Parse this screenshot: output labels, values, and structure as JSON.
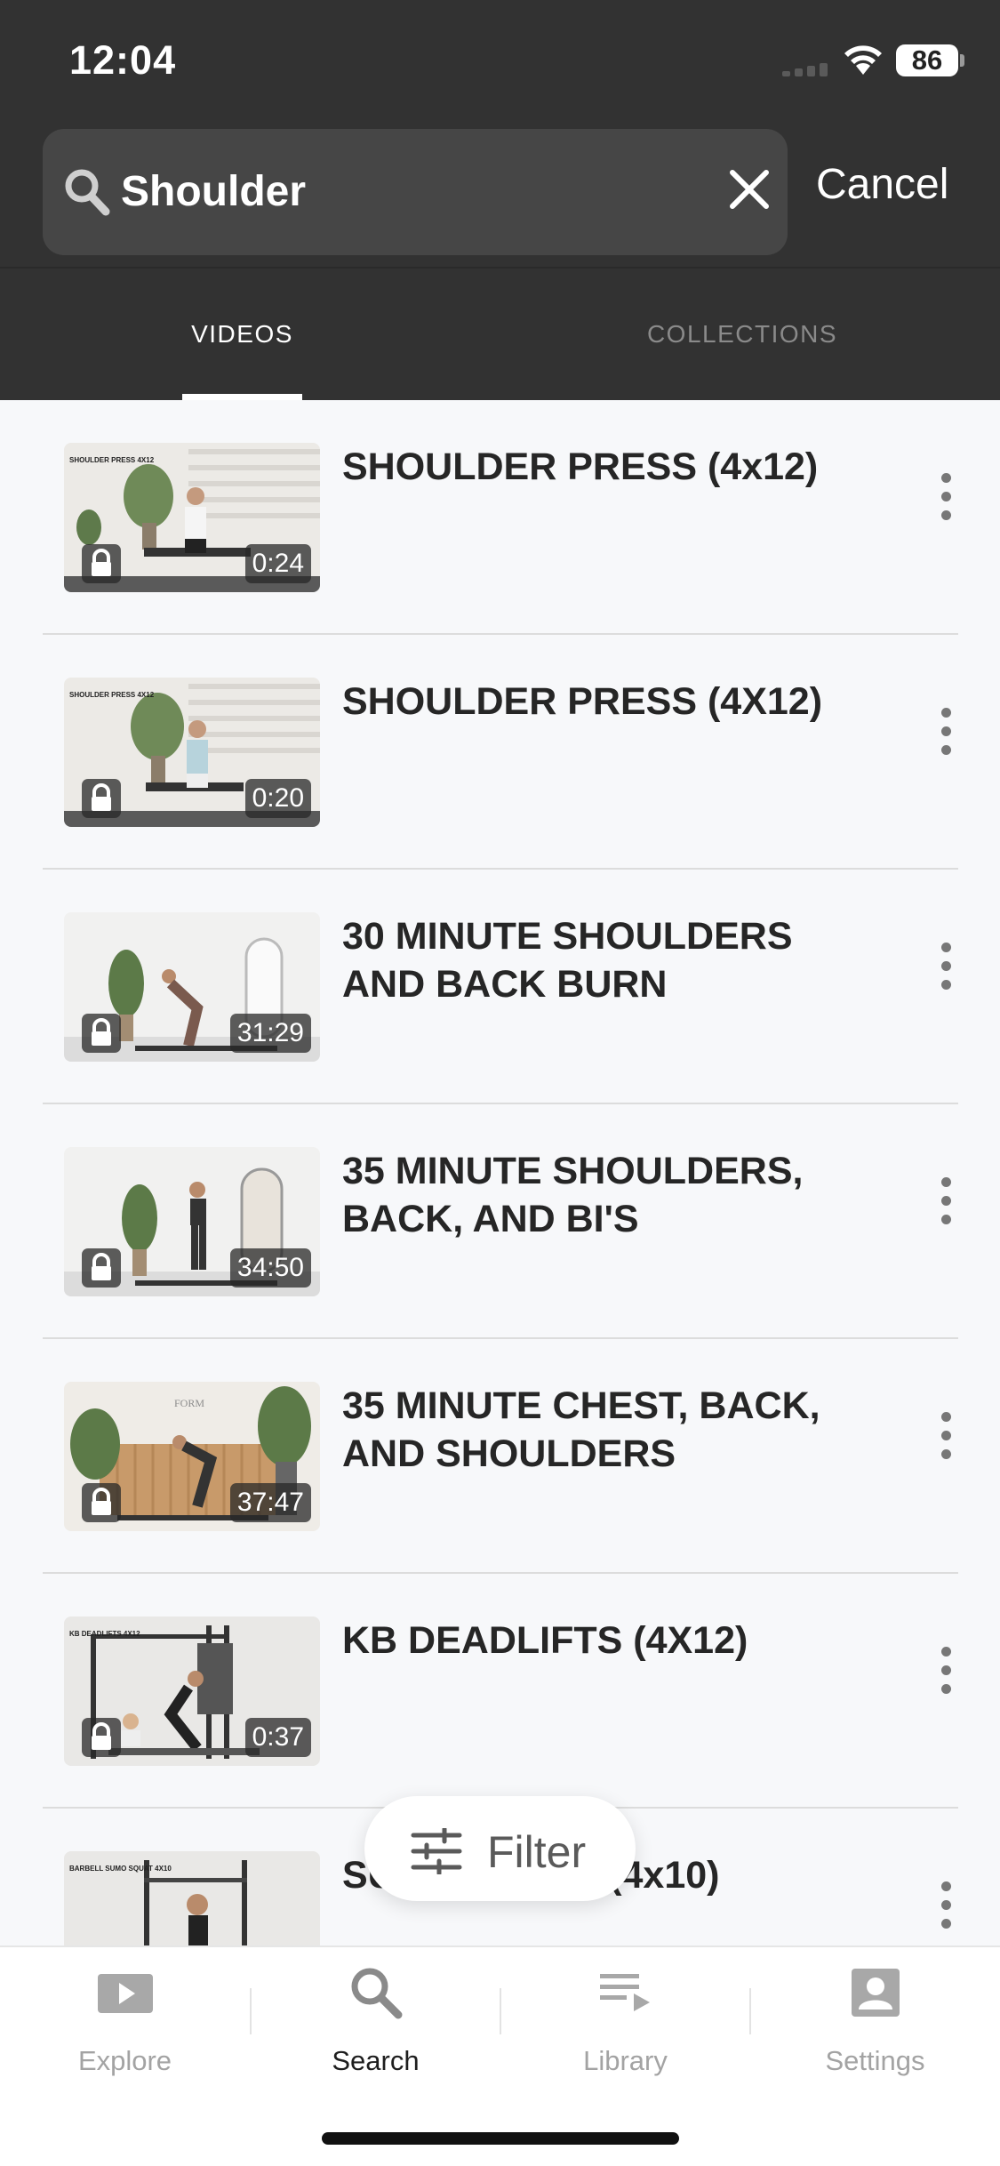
{
  "status_bar": {
    "time": "12:04",
    "battery": "86"
  },
  "search": {
    "query": "Shoulder",
    "cancel_label": "Cancel"
  },
  "tabs": [
    {
      "label": "VIDEOS",
      "active": true
    },
    {
      "label": "COLLECTIONS",
      "active": false
    }
  ],
  "results": [
    {
      "title": "SHOULDER PRESS (4x12)",
      "duration": "0:24",
      "thumb_overlay": "SHOULDER PRESS 4X12",
      "locked": true
    },
    {
      "title": "SHOULDER PRESS (4X12)",
      "duration": "0:20",
      "thumb_overlay": "SHOULDER PRESS 4X12",
      "locked": true
    },
    {
      "title": "30 MINUTE SHOULDERS AND BACK BURN",
      "duration": "31:29",
      "locked": true
    },
    {
      "title": "35 MINUTE SHOULDERS, BACK, AND BI'S",
      "duration": "34:50",
      "locked": true
    },
    {
      "title": "35 MINUTE CHEST, BACK, AND SHOULDERS",
      "duration": "37:47",
      "thumb_overlay": "FORM",
      "locked": true
    },
    {
      "title": "KB DEADLIFTS (4X12)",
      "duration": "0:37",
      "thumb_overlay": "KB DEADLIFTS 4X12",
      "locked": true
    },
    {
      "title": "SUMO SQUAT (4x10)",
      "thumb_overlay": "BARBELL SUMO SQUAT 4X10",
      "locked": true
    }
  ],
  "filter": {
    "label": "Filter"
  },
  "tabbar": [
    {
      "label": "Explore",
      "icon": "play-icon",
      "active": false
    },
    {
      "label": "Search",
      "icon": "search-icon",
      "active": true
    },
    {
      "label": "Library",
      "icon": "playlist-icon",
      "active": false
    },
    {
      "label": "Settings",
      "icon": "account-icon",
      "active": false
    }
  ],
  "colors": {
    "header_bg": "#323232",
    "list_bg": "#f7f8fa",
    "title_text": "#262626",
    "inactive_tab": "#a3a3a3"
  }
}
